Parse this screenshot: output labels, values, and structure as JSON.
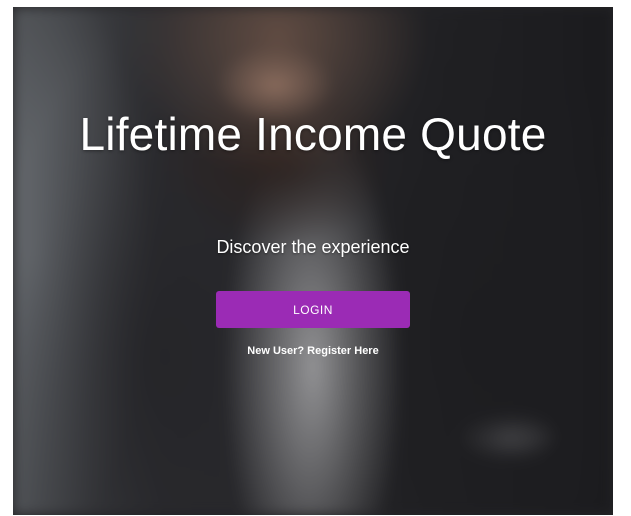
{
  "hero": {
    "title": "Lifetime Income Quote",
    "subtitle": "Discover the experience"
  },
  "actions": {
    "login_label": "LOGIN",
    "register_label": "New User? Register Here"
  },
  "colors": {
    "accent": "#9b2bb5"
  }
}
